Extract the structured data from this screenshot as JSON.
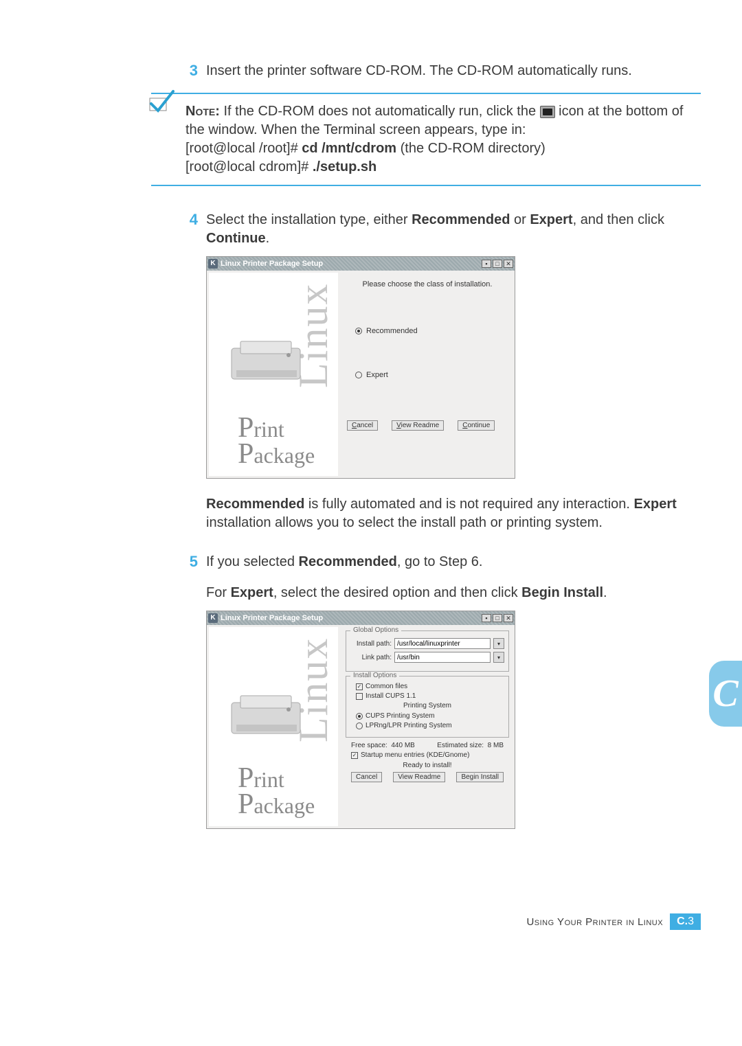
{
  "steps": {
    "s3_num": "3",
    "s3_text_a": "Insert the printer software CD-ROM. The CD-ROM automatically runs.",
    "s4_num": "4",
    "s4_text_a": "Select the installation type, either ",
    "s4_rec": "Recommended",
    "s4_text_b": " or ",
    "s4_exp": "Expert",
    "s4_text_c": ", and then click ",
    "s4_cont": "Continue",
    "s4_text_d": ".",
    "s5_num": "5",
    "s5_text_a": "If you selected ",
    "s5_rec": "Recommended",
    "s5_text_b": ", go to Step 6.",
    "s5_text_c": "For ",
    "s5_exp": "Expert",
    "s5_text_d": ", select the desired option and then click ",
    "s5_begin": "Begin Install",
    "s5_text_e": "."
  },
  "note": {
    "label": "Note:",
    "text_a": " If the CD-ROM does not automatically run, click the ",
    "text_b": " icon at the bottom of the window. When the Terminal screen appears, type in:",
    "line2_a": "[root@local /root]# ",
    "line2_b": "cd /mnt/cdrom",
    "line2_c": " (the CD-ROM directory)",
    "line3_a": "[root@local cdrom]# ",
    "line3_b": "./setup.sh"
  },
  "win1": {
    "k": "K",
    "title": "Linux Printer Package Setup",
    "linux": "Linux",
    "pkg_p": "P",
    "pkg_rint": "rint",
    "pkg_pa": "P",
    "pkg_ackage": "ackage",
    "msg": "Please choose the class of installation.",
    "opt1": "Recommended",
    "opt2": "Expert",
    "cancel": "Cancel",
    "viewreadme": "View Readme",
    "continue": "Continue"
  },
  "explain1_a": "Recommended",
  "explain1_b": " is fully automated and is not required any interaction. ",
  "explain1_c": "Expert",
  "explain1_d": " installation allows you to select the install path or printing system.",
  "win2": {
    "k": "K",
    "title": "Linux Printer Package Setup",
    "linux": "Linux",
    "pkg_rint": "rint",
    "pkg_ackage": "ackage",
    "globalopts": "Global Options",
    "installpath_label": "Install path:",
    "installpath_value": "/usr/local/linuxprinter",
    "linkpath_label": "Link path:",
    "linkpath_value": "/usr/bin",
    "installopts": "Install Options",
    "commonfiles": "Common files",
    "installcups": "Install CUPS 1.1",
    "printingsystem": "Printing System",
    "cupsps": "CUPS Printing System",
    "lprps": "LPRng/LPR Printing System",
    "freespace_label": "Free space:",
    "freespace_val": "440 MB",
    "estsize_label": "Estimated size:",
    "estsize_val": "8 MB",
    "startup": "Startup menu entries (KDE/Gnome)",
    "ready": "Ready to install!",
    "cancel": "Cancel",
    "viewreadme": "View Readme",
    "begininstall": "Begin Install"
  },
  "footer": {
    "text": "Using Your Printer in Linux",
    "page_a": "C.",
    "page_b": "3"
  },
  "appendix": "C"
}
